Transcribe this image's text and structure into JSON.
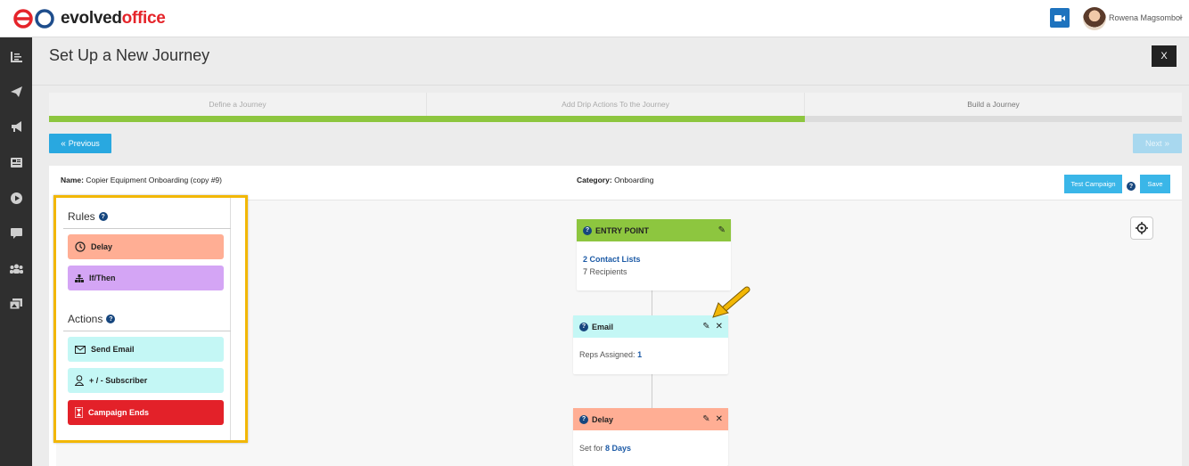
{
  "app": {
    "logo_text_1": "evolved",
    "logo_text_2": "office",
    "user_name": "Rowena Magsombol",
    "accent": "#29a8e0",
    "brand_red": "#e5242a"
  },
  "sidebar": {
    "icons": [
      "chart-bar-icon",
      "paper-plane-icon",
      "megaphone-icon",
      "newspaper-icon",
      "play-icon",
      "chat-icon",
      "users-icon",
      "images-icon"
    ]
  },
  "page": {
    "title": "Set Up a New Journey",
    "close_label": "X"
  },
  "steps": [
    {
      "label": "Define a Journey",
      "state": "done"
    },
    {
      "label": "Add Drip Actions To the Journey",
      "state": "done"
    },
    {
      "label": "Build a Journey",
      "state": "current"
    }
  ],
  "nav": {
    "previous_label": "Previous",
    "next_label": "Next"
  },
  "campaign": {
    "name_label": "Name:",
    "name_value": "Copier Equipment Onboarding (copy #9)",
    "category_label": "Category:",
    "category_value": "Onboarding",
    "test_label": "Test Campaign",
    "save_label": "Save",
    "help_glyph": "?"
  },
  "toolbox": {
    "rules_title": "Rules",
    "actions_title": "Actions",
    "rules": [
      {
        "label": "Delay",
        "color": "#ffae94",
        "icon": "clock-icon"
      },
      {
        "label": "If/Then",
        "color": "#d4a5f5",
        "icon": "sitemap-icon"
      }
    ],
    "actions": [
      {
        "label": "Send Email",
        "color": "#c4f7f5",
        "icon": "envelope-icon"
      },
      {
        "label": "+ / - Subscriber",
        "color": "#c4f7f5",
        "icon": "user-icon"
      },
      {
        "label": "Campaign Ends",
        "color": "#e32129",
        "icon": "hourglass-icon"
      }
    ]
  },
  "flow": {
    "entry": {
      "title": "ENTRY POINT",
      "color": "#8dc63f",
      "lists": "2 Contact Lists",
      "recipients_count": "7",
      "recipients_label": "Recipients"
    },
    "email": {
      "title": "Email",
      "color": "#c4f7f5",
      "reps_label": "Reps Assigned:",
      "reps_value": "1"
    },
    "delay": {
      "title": "Delay",
      "color": "#ffae94",
      "set_label": "Set for",
      "set_value": "8 Days"
    }
  }
}
